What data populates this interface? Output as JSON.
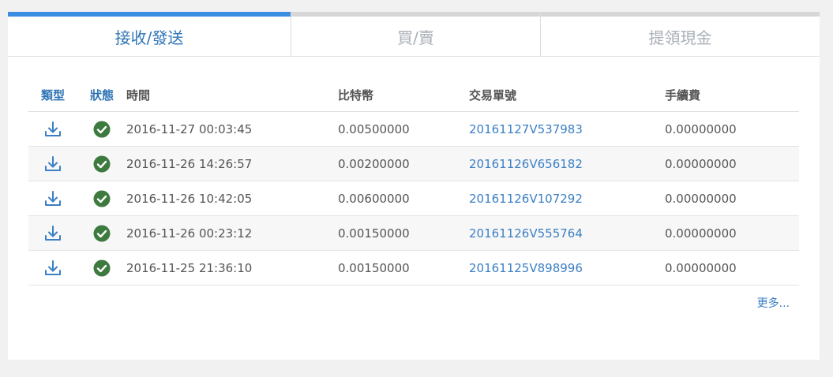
{
  "tabs": [
    {
      "label": "接收/發送",
      "active": true
    },
    {
      "label": "買/賣",
      "active": false
    },
    {
      "label": "提領現金",
      "active": false
    }
  ],
  "table": {
    "headers": {
      "type": "類型",
      "status": "狀態",
      "time": "時間",
      "btc": "比特幣",
      "txid": "交易單號",
      "fee": "手續費"
    },
    "rows": [
      {
        "type_icon": "download-icon",
        "status_icon": "check-circle-icon",
        "time": "2016-11-27 00:03:45",
        "btc": "0.00500000",
        "txid": "20161127V537983",
        "fee": "0.00000000"
      },
      {
        "type_icon": "download-icon",
        "status_icon": "check-circle-icon",
        "time": "2016-11-26 14:26:57",
        "btc": "0.00200000",
        "txid": "20161126V656182",
        "fee": "0.00000000"
      },
      {
        "type_icon": "download-icon",
        "status_icon": "check-circle-icon",
        "time": "2016-11-26 10:42:05",
        "btc": "0.00600000",
        "txid": "20161126V107292",
        "fee": "0.00000000"
      },
      {
        "type_icon": "download-icon",
        "status_icon": "check-circle-icon",
        "time": "2016-11-26 00:23:12",
        "btc": "0.00150000",
        "txid": "20161126V555764",
        "fee": "0.00000000"
      },
      {
        "type_icon": "download-icon",
        "status_icon": "check-circle-icon",
        "time": "2016-11-25 21:36:10",
        "btc": "0.00150000",
        "txid": "20161125V898996",
        "fee": "0.00000000"
      }
    ]
  },
  "more_link": "更多...",
  "colors": {
    "accent": "#3a8de0",
    "link": "#3b7fc4",
    "success": "#3c7a3e"
  }
}
